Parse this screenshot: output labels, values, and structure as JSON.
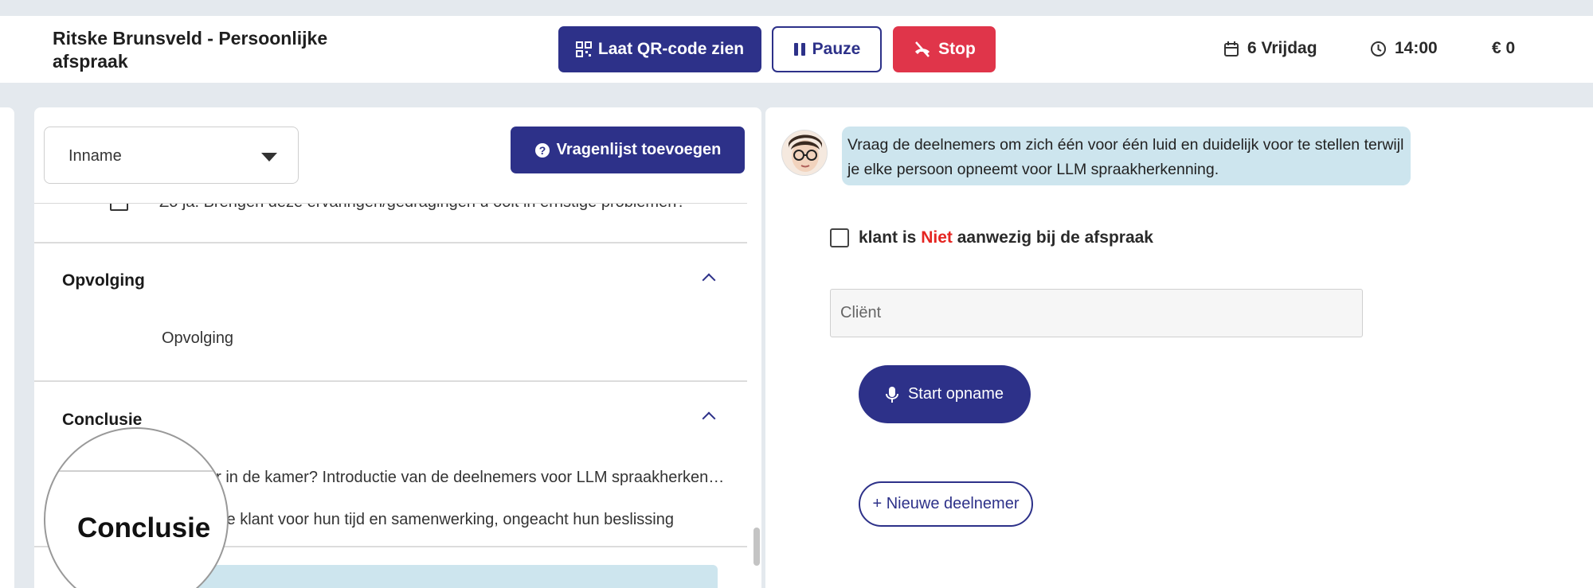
{
  "header": {
    "title": "Ritske Brunsveld - Persoonlijke afspraak",
    "qr_label": "Laat QR-code zien",
    "pause_label": "Pauze",
    "stop_label": "Stop",
    "date": "6 Vrijdag",
    "time": "14:00",
    "price": "€ 0"
  },
  "left": {
    "select_value": "Inname",
    "add_questionnaire_label": "Vragenlijst toevoegen",
    "items": {
      "partial_question": "Zo ja: Brengen deze ervaringen/gedragingen u ooit in ernstige problemen?",
      "section_opvolging": "Opvolging",
      "opvolging_item": "Opvolging",
      "section_conclusie": "Conclusie",
      "conclusie_q1": "Wie is er in de kamer? Introductie van de deelnemers voor LLM spraakherkenning",
      "conclusie_q2": "Bedank de klant voor hun tijd en samenwerking, ongeacht hun beslissing"
    },
    "magnifier_text": "Conclusie"
  },
  "right": {
    "instruction": "Vraag de deelnemers om zich één voor één luid en duidelijk voor te stellen terwijl je elke persoon opneemt voor LLM spraakherkenning.",
    "absent_prefix": "klant is ",
    "absent_niet": "Niet",
    "absent_suffix": " aanwezig bij de afspraak",
    "client_placeholder": "Cliënt",
    "start_label": "Start opname",
    "new_participant_label": "+ Nieuwe deelnemer"
  },
  "colors": {
    "primary": "#2d3189",
    "danger": "#e0354a",
    "highlight": "#cde5ee"
  }
}
